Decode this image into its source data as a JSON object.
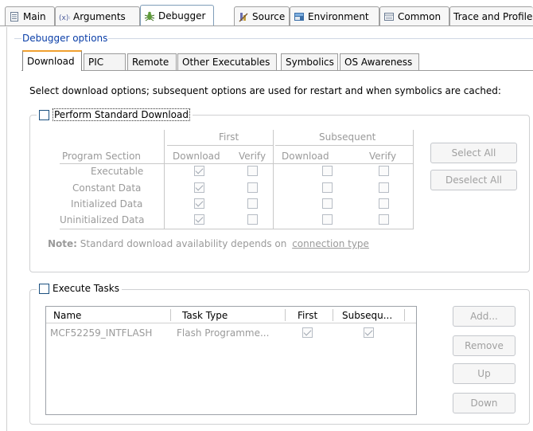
{
  "top_tabs": [
    {
      "label": "Main",
      "icon": "document-icon"
    },
    {
      "label": "Arguments",
      "icon": "arguments-icon"
    },
    {
      "label": "Debugger",
      "icon": "bug-icon",
      "active": true
    },
    {
      "label": "Source",
      "icon": "source-icon"
    },
    {
      "label": "Environment",
      "icon": "environment-icon"
    },
    {
      "label": "Common",
      "icon": "common-icon"
    },
    {
      "label": "Trace and Profile",
      "icon": ""
    }
  ],
  "group_title": "Debugger options",
  "inner_tabs": [
    {
      "label": "Download",
      "active": true
    },
    {
      "label": "PIC"
    },
    {
      "label": "Remote"
    },
    {
      "label": "Other Executables"
    },
    {
      "label": "Symbolics"
    },
    {
      "label": "OS Awareness"
    }
  ],
  "description": "Select download options; subsequent options are used for restart and when symbolics are cached:",
  "standard_download": {
    "label": "Perform Standard Download",
    "checked": false,
    "header_first": "First",
    "header_subsequent": "Subsequent",
    "col_program_section": "Program Section",
    "col_download": "Download",
    "col_verify": "Verify",
    "rows": [
      {
        "section": "Executable",
        "first_download": true,
        "first_verify": false,
        "sub_download": false,
        "sub_verify": false
      },
      {
        "section": "Constant Data",
        "first_download": true,
        "first_verify": false,
        "sub_download": false,
        "sub_verify": false
      },
      {
        "section": "Initialized Data",
        "first_download": true,
        "first_verify": false,
        "sub_download": false,
        "sub_verify": false
      },
      {
        "section": "Uninitialized Data",
        "first_download": true,
        "first_verify": false,
        "sub_download": false,
        "sub_verify": false
      }
    ],
    "select_all": "Select All",
    "deselect_all": "Deselect All",
    "note_label": "Note:",
    "note_text": "Standard download availability depends on",
    "note_link": "connection type"
  },
  "execute_tasks": {
    "label": "Execute Tasks",
    "checked": false,
    "columns": [
      "Name",
      "Task Type",
      "First",
      "Subsequ..."
    ],
    "rows": [
      {
        "name": "MCF52259_INTFLASH",
        "task_type": "Flash Programme...",
        "first": true,
        "subsequent": true
      }
    ],
    "buttons": {
      "add": "Add...",
      "remove": "Remove",
      "up": "Up",
      "down": "Down"
    }
  }
}
